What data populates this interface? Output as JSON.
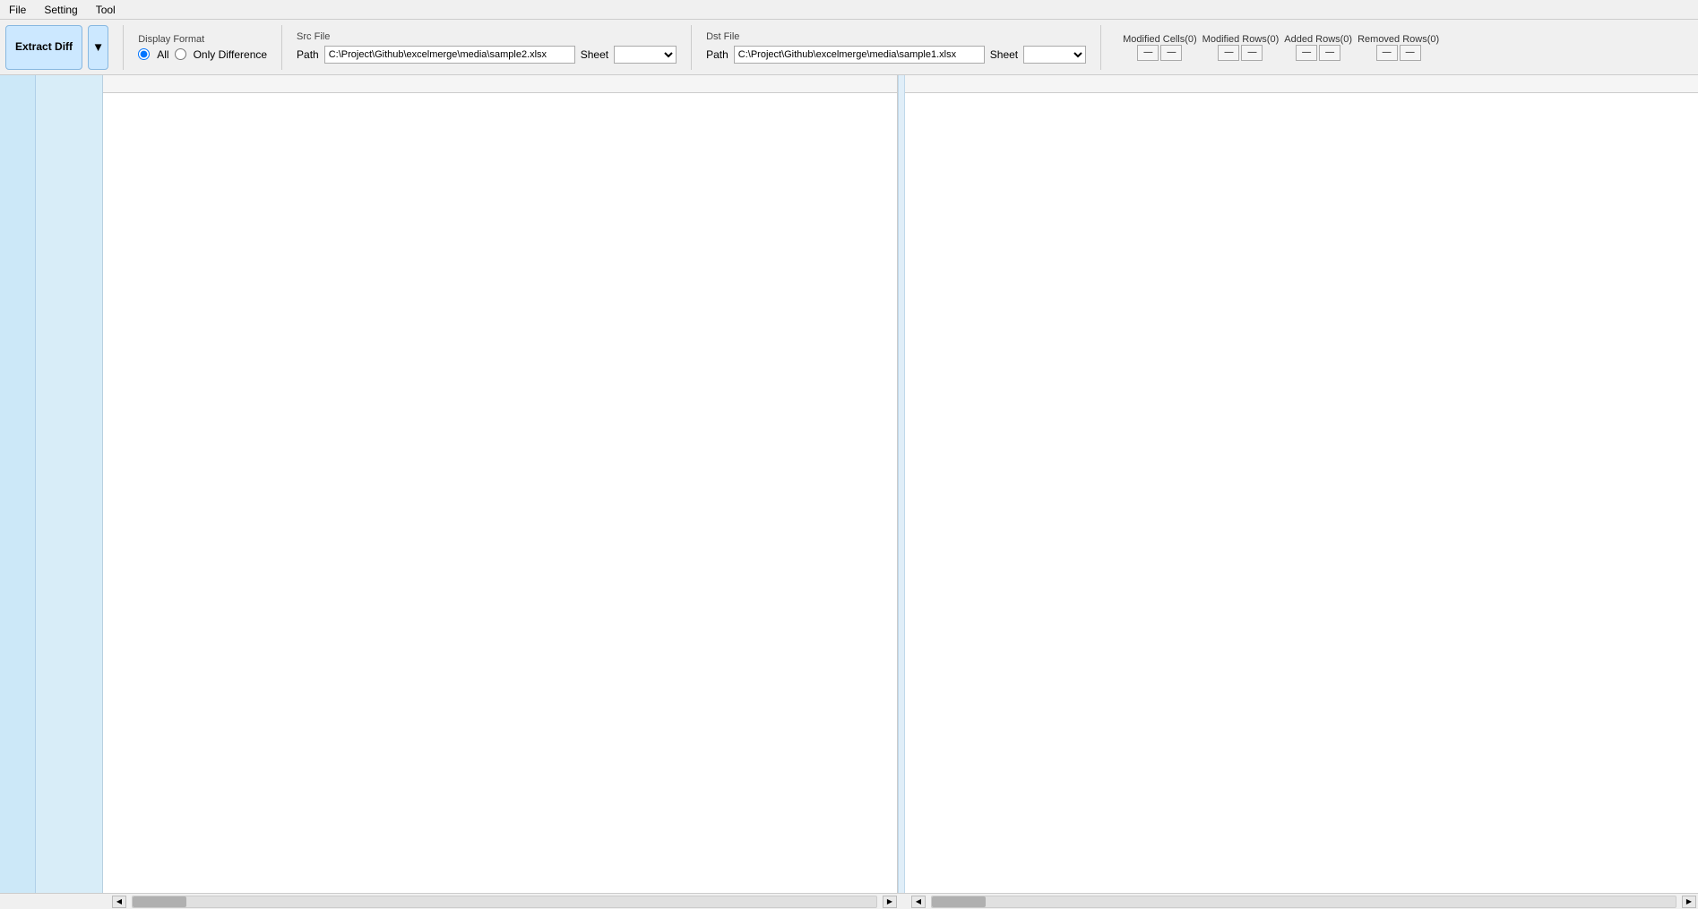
{
  "menu": {
    "items": [
      "File",
      "Setting",
      "Tool"
    ]
  },
  "toolbar": {
    "extract_diff_label": "Extract Diff",
    "dropdown_arrow": "▼",
    "display_format": {
      "label": "Display Format",
      "option_all": "All",
      "option_diff": "Only Difference"
    },
    "src_file": {
      "label": "Src File",
      "path_label": "Path",
      "path_value": "C:\\Project\\Github\\excelmerge\\media\\sample2.xlsx",
      "sheet_label": "Sheet"
    },
    "dst_file": {
      "label": "Dst File",
      "path_label": "Path",
      "path_value": "C:\\Project\\Github\\excelmerge\\media\\sample1.xlsx",
      "sheet_label": "Sheet"
    },
    "stats": {
      "modified_cells": "Modified Cells(0)",
      "modified_rows": "Modified Rows(0)",
      "added_rows": "Added Rows(0)",
      "removed_rows": "Removed Rows(0)"
    },
    "stat_buttons": [
      "—",
      "—",
      "—",
      "—",
      "—",
      "—",
      "—",
      "—"
    ]
  },
  "scrollbar": {
    "left_arrow": "◀",
    "right_arrow": "▶"
  }
}
